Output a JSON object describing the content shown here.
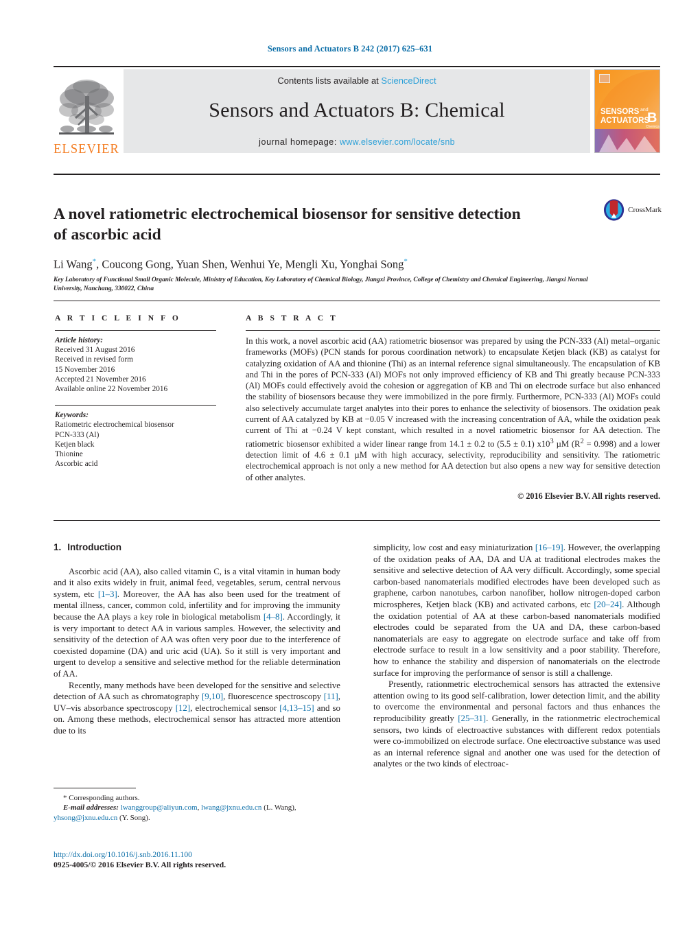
{
  "running_head": "Sensors and Actuators B 242 (2017) 625–631",
  "masthead": {
    "contents_prefix": "Contents lists available at ",
    "sciencedirect": "ScienceDirect",
    "journal_title": "Sensors and Actuators B: Chemical",
    "homepage_prefix": "journal homepage: ",
    "homepage_url": "www.elsevier.com/locate/snb",
    "publisher": "ELSEVIER",
    "cover": {
      "line1": "SENSORS",
      "line1_small": "and",
      "line2": "ACTUATORS",
      "letter": "B",
      "letter_sub": "Chemical"
    }
  },
  "article": {
    "title": "A novel ratiometric electrochemical biosensor for sensitive detection of ascorbic acid",
    "crossmark_label": "CrossMark",
    "authors_html": "Li Wang<sup>*</sup>, Coucong Gong, Yuan Shen, Wenhui Ye, Mengli Xu, Yonghai Song<sup>*</sup>",
    "affiliation": "Key Laboratory of Functional Small Organic Molecule, Ministry of Education, Key Laboratory of Chemical Biology, Jiangxi Province, College of Chemistry and Chemical Engineering, Jiangxi Normal University, Nanchang, 330022, China"
  },
  "info": {
    "heading": "A R T I C L E   I N F O",
    "history_label": "Article history:",
    "history": [
      "Received 31 August 2016",
      "Received in revised form",
      "15 November 2016",
      "Accepted 21 November 2016",
      "Available online 22 November 2016"
    ],
    "keywords_label": "Keywords:",
    "keywords": [
      "Ratiometric electrochemical biosensor",
      "PCN-333 (Al)",
      "Ketjen black",
      "Thionine",
      "Ascorbic acid"
    ]
  },
  "abstract": {
    "heading": "A B S T R A C T",
    "body_html": "In this work, a novel ascorbic acid (AA) ratiometric biosensor was prepared by using the PCN-333 (Al) metal–organic frameworks (MOFs) (PCN stands for porous coordination network) to encapsulate Ketjen black (KB) as catalyst for catalyzing oxidation of AA and thionine (Thi) as an internal reference signal simultaneously. The encapsulation of KB and Thi in the pores of PCN-333 (Al) MOFs not only improved efficiency of KB and Thi greatly because PCN-333 (Al) MOFs could effectively avoid the cohesion or aggregation of KB and Thi on electrode surface but also enhanced the stability of biosensors because they were immobilized in the pore firmly. Furthermore, PCN-333 (Al) MOFs could also selectively accumulate target analytes into their pores to enhance the selectivity of biosensors. The oxidation peak current of AA catalyzed by KB at −0.05 V increased with the increasing concentration of AA, while the oxidation peak current of Thi at −0.24 V kept constant, which resulted in a novel ratiometric biosensor for AA detection. The ratiometric biosensor exhibited a wider linear range from 14.1 ± 0.2 to (5.5 ± 0.1) x10<sup>3</sup> µM (R<sup>2</sup> = 0.998) and a lower detection limit of 4.6 ± 0.1 µM with high accuracy, selectivity, reproducibility and sensitivity. The ratiometric electrochemical approach is not only a new method for AA detection but also opens a new way for sensitive detection of other analytes.",
    "copyright": "© 2016 Elsevier B.V. All rights reserved."
  },
  "body": {
    "section_number": "1.",
    "section_title": "Introduction",
    "left_paragraphs_html": [
      "Ascorbic acid (AA), also called vitamin C, is a vital vitamin in human body and it also exits widely in fruit, animal feed, vegetables, serum, central nervous system, etc <span class=\"ref\">[1–3]</span>. Moreover, the AA has also been used for the treatment of mental illness, cancer, common cold, infertility and for improving the immunity because the AA plays a key role in biological metabolism <span class=\"ref\">[4–8]</span>. Accordingly, it is very important to detect AA in various samples. However, the selectivity and sensitivity of the detection of AA was often very poor due to the interference of coexisted dopamine (DA) and uric acid (UA). So it still is very important and urgent to develop a sensitive and selective method for the reliable determination of AA.",
      "Recently, many methods have been developed for the sensitive and selective detection of AA such as chromatography <span class=\"ref\">[9,10]</span>, fluorescence spectroscopy <span class=\"ref\">[11]</span>, UV–vis absorbance spectroscopy <span class=\"ref\">[12]</span>, electrochemical sensor <span class=\"ref\">[4,13–15]</span> and so on. Among these methods, electrochemical sensor has attracted more attention due to its"
    ],
    "right_paragraphs_html": [
      "simplicity, low cost and easy miniaturization <span class=\"ref\">[16–19]</span>. However, the overlapping of the oxidation peaks of AA, DA and UA at traditional electrodes makes the sensitive and selective detection of AA very difficult. Accordingly, some special carbon-based nanomaterials modified electrodes have been developed such as graphene, carbon nanotubes, carbon nanofiber, hollow nitrogen-doped carbon microspheres, Ketjen black (KB) and activated carbons, etc <span class=\"ref\">[20–24]</span>. Although the oxidation potential of AA at these carbon-based nanomaterials modified electrodes could be separated from the UA and DA, these carbon-based nanomaterials are easy to aggregate on electrode surface and take off from electrode surface to result in a low sensitivity and a poor stability. Therefore, how to enhance the stability and dispersion of nanomaterials on the electrode surface for improving the performance of sensor is still a challenge.",
      "Presently, rationmetric electrochemical sensors has attracted the extensive attention owing to its good self-calibration, lower detection limit, and the ability to overcome the environmental and personal factors and thus enhances the reproducibility greatly <span class=\"ref\">[25–31]</span>. Generally, in the rationmetric electrochemical sensors, two kinds of electroactive substances with different redox potentials were co-immobilized on electrode surface. One electroactive substance was used as an internal reference signal and another one was used for the detection of analytes or the two kinds of electroac-"
    ]
  },
  "footnotes": {
    "corresponding": "Corresponding authors.",
    "email_label": "E-mail addresses:",
    "email1": "lwanggroup@aliyun.com",
    "email2": "lwang@jxnu.edu.cn",
    "email_owner1": "(L. Wang),",
    "email3": "yhsong@jxnu.edu.cn",
    "email_owner2": "(Y. Song).",
    "doi": "http://dx.doi.org/10.1016/j.snb.2016.11.100",
    "issn": "0925-4005/© 2016 Elsevier B.V. All rights reserved."
  },
  "colors": {
    "link_blue": "#0b6ea8",
    "sciencedirect_blue": "#2ba0d8",
    "elsevier_orange": "#f47c20"
  }
}
